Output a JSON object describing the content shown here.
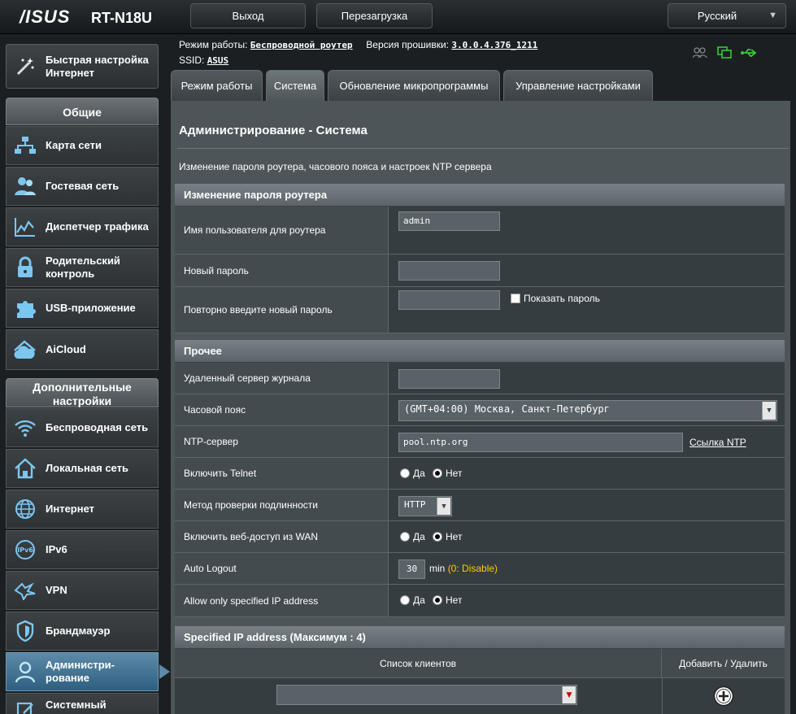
{
  "header": {
    "logo": "/ISUS",
    "model": "RT-N18U",
    "logout_label": "Выход",
    "reboot_label": "Перезагрузка",
    "language": "Русский"
  },
  "info": {
    "mode_label": "Режим работы:",
    "mode_value": "Беспроводной роутер",
    "firmware_label": "Версия прошивки:",
    "firmware_value": "3.0.0.4.376_1211",
    "ssid_label": "SSID:",
    "ssid_value": "ASUS"
  },
  "sidebar": {
    "quick_setup": "Быстрая настройка Интернет",
    "general_header": "Общие",
    "general_items": [
      {
        "label": "Карта сети",
        "icon": "network-map-icon"
      },
      {
        "label": "Гостевая сеть",
        "icon": "guest-network-icon"
      },
      {
        "label": "Диспетчер трафика",
        "icon": "traffic-manager-icon"
      },
      {
        "label": "Родительский контроль",
        "icon": "parental-control-icon"
      },
      {
        "label": "USB-приложение",
        "icon": "usb-app-icon"
      },
      {
        "label": "AiCloud",
        "icon": "aicloud-icon"
      }
    ],
    "advanced_header": "Дополнительные настройки",
    "advanced_items": [
      {
        "label": "Беспроводная сеть",
        "icon": "wireless-icon"
      },
      {
        "label": "Локальная сеть",
        "icon": "lan-icon"
      },
      {
        "label": "Интернет",
        "icon": "internet-icon"
      },
      {
        "label": "IPv6",
        "icon": "ipv6-icon"
      },
      {
        "label": "VPN",
        "icon": "vpn-icon"
      },
      {
        "label": "Брандмауэр",
        "icon": "firewall-icon"
      },
      {
        "label": "Администри-рование",
        "icon": "administration-icon"
      },
      {
        "label": "Системный",
        "icon": "system-log-icon"
      }
    ]
  },
  "tabs": [
    {
      "label": "Режим работы"
    },
    {
      "label": "Система"
    },
    {
      "label": "Обновление микропрограммы"
    },
    {
      "label": "Управление настройками"
    }
  ],
  "page": {
    "title": "Администрирование - Система",
    "description": "Изменение пароля роутера, часового пояса и настроек NTP сервера"
  },
  "password_section": {
    "header": "Изменение пароля роутера",
    "username_label": "Имя пользователя для роутера",
    "username_value": "admin",
    "new_password_label": "Новый пароль",
    "new_password_value": "",
    "repeat_password_label": "Повторно введите новый пароль",
    "repeat_password_value": "",
    "show_password_label": "Показать пароль"
  },
  "misc_section": {
    "header": "Прочее",
    "log_server_label": "Удаленный сервер журнала",
    "log_server_value": "",
    "timezone_label": "Часовой пояс",
    "timezone_value": "(GMT+04:00) Москва, Санкт-Петербург",
    "ntp_label": "NTP-сервер",
    "ntp_value": "pool.ntp.org",
    "ntp_link": "Ссылка NTP",
    "telnet_label": "Включить Telnet",
    "auth_label": "Метод проверки подлинности",
    "auth_value": "HTTP",
    "wan_access_label": "Включить веб-доступ из WAN",
    "auto_logout_label": "Auto Logout",
    "auto_logout_value": "30",
    "auto_logout_unit": "min",
    "auto_logout_hint": "(0: Disable)",
    "allow_ip_label": "Allow only specified IP address",
    "yes": "Да",
    "no": "Нет"
  },
  "ip_section": {
    "header": "Specified IP address (Максимум : 4)",
    "col_clients": "Список клиентов",
    "col_add_remove": "Добавить / Удалить"
  }
}
